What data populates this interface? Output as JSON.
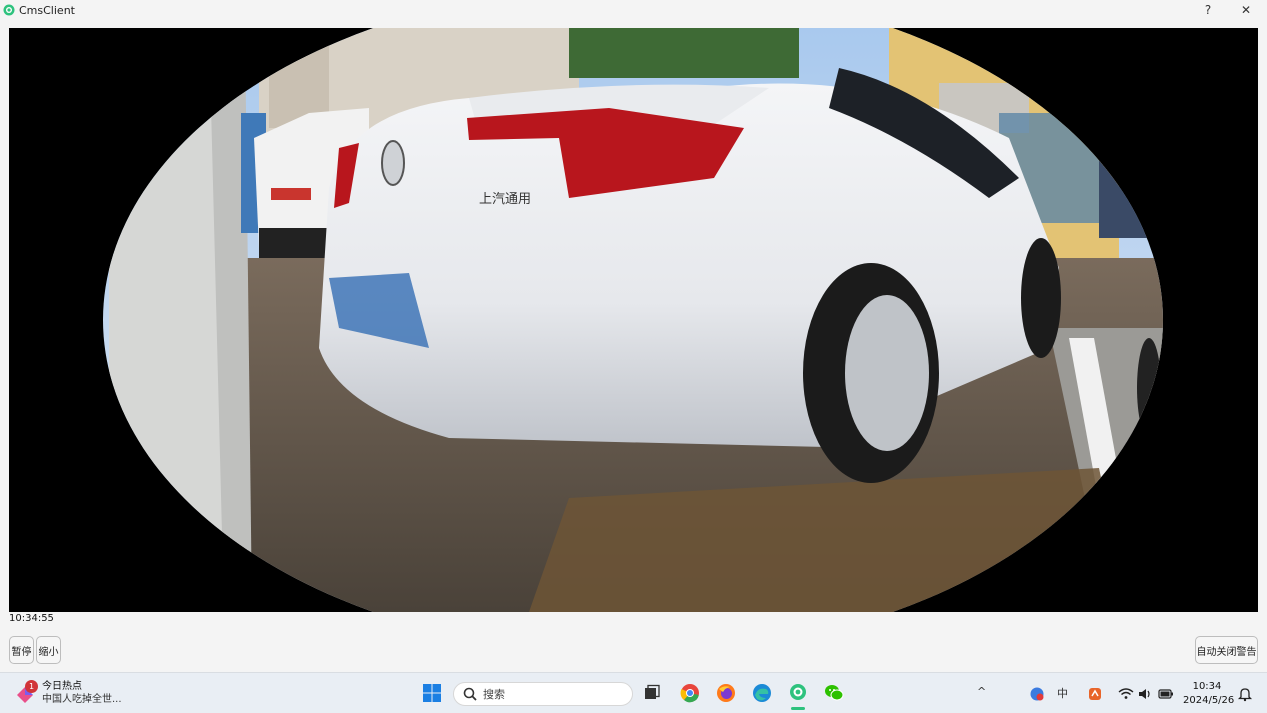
{
  "window": {
    "title": "CmsClient",
    "help_label": "?",
    "close_label": "✕"
  },
  "video": {
    "timestamp": "10:34:55",
    "plate_text": "上汽通用"
  },
  "controls": {
    "pause_label": "暂停",
    "shrink_label": "缩小",
    "auto_close_label": "自动关闭警告"
  },
  "taskbar": {
    "news": {
      "title": "今日热点",
      "subtitle": "中国人吃掉全世...",
      "badge": "1"
    },
    "search_placeholder": "搜索",
    "tray": {
      "ime_label": "中",
      "chevron": "^"
    },
    "clock": {
      "time": "10:34",
      "date": "2024/5/26"
    }
  }
}
